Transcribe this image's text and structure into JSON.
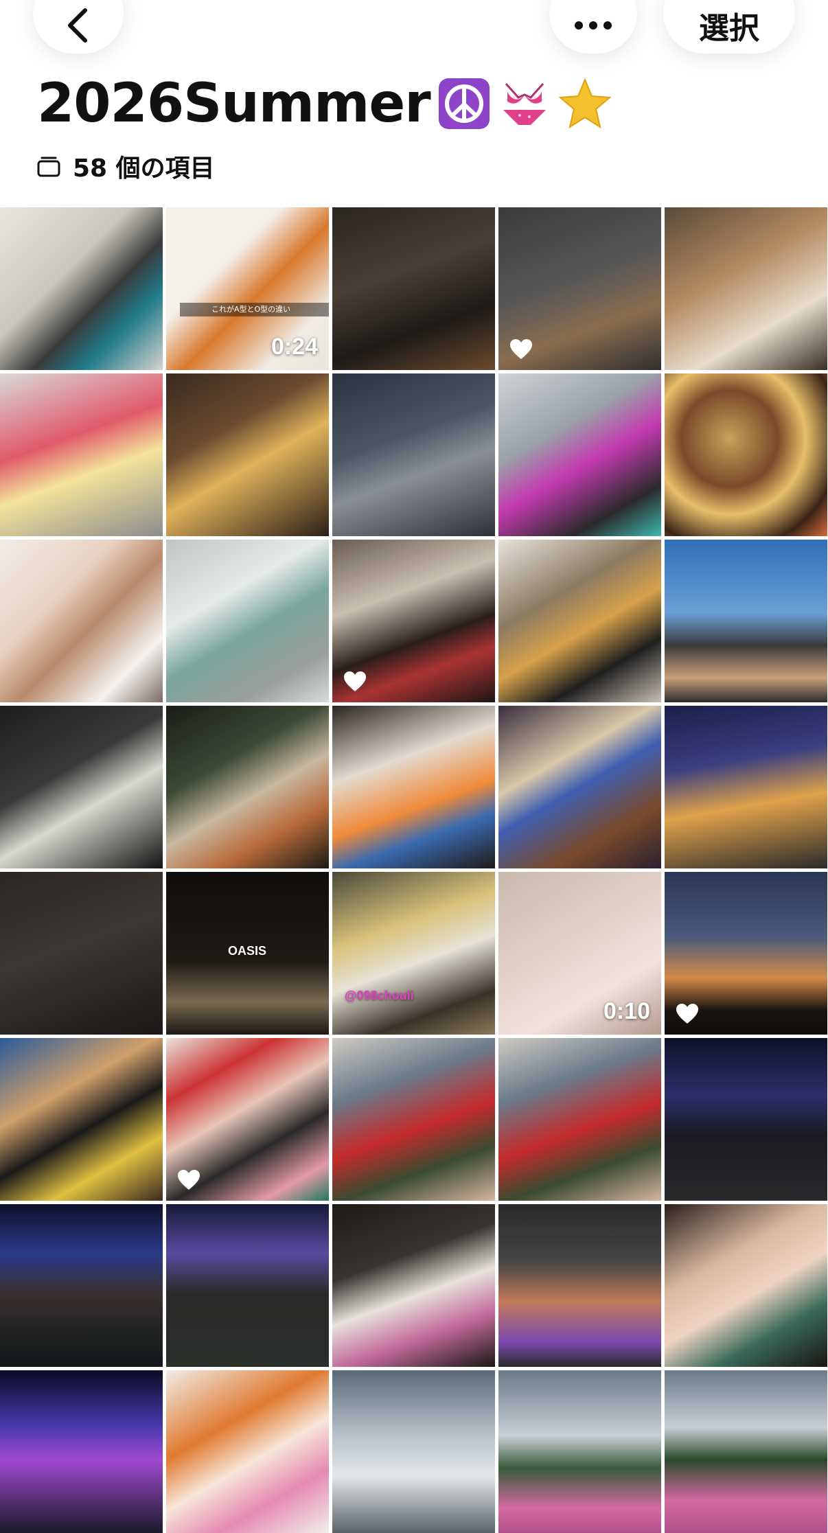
{
  "header": {
    "select_label": "選択",
    "back_icon": "chevron-left-icon",
    "more_icon": "ellipsis-icon"
  },
  "album": {
    "title": "2026Summer",
    "title_emojis": [
      "peace-symbol-emoji",
      "bikini-emoji",
      "star-emoji"
    ],
    "count_label": "58 個の項目",
    "count_icon": "stack-icon"
  },
  "photos": [
    {
      "bg": "linear-gradient(135deg,#e8e6e0 0%,#cbc7bd 40%,#3a3a3a 60%,#1f7a8a 75%,#d7d4cc 100%)"
    },
    {
      "bg": "linear-gradient(135deg,#f4f1ea 0%,#f4f1ea 35%,#d9782c 55%,#f0ece4 80%,#e9e5dd 100%)",
      "duration": "0:24",
      "caption": "これがA型とO型の違い"
    },
    {
      "bg": "linear-gradient(160deg,#2a2520 0%,#4a3f35 40%,#1d1a17 70%,#6b4a2d 100%)"
    },
    {
      "bg": "linear-gradient(160deg,#3b3b3b 0%,#575757 45%,#8a6d4f 70%,#2f2f2f 100%)",
      "favorite": true
    },
    {
      "bg": "linear-gradient(150deg,#5a4a3a 0%,#b48a60 40%,#e8dccb 70%,#3a2e24 100%)"
    },
    {
      "bg": "linear-gradient(160deg,#d9d9d9 0%,#e05a6a 40%,#f4e39a 60%,#8c8c8c 100%)"
    },
    {
      "bg": "linear-gradient(150deg,#3a2a1e 0%,#6b4b30 35%,#e0b25a 55%,#2b1f17 100%)"
    },
    {
      "bg": "linear-gradient(160deg,#2a3340 0%,#4b5766 40%,#8a8f95 60%,#2d3038 100%)"
    },
    {
      "bg": "linear-gradient(150deg,#cfd3d6 0%,#9aa2a8 35%,#c33ab0 55%,#2a2a2a 80%,#3fb7b0 100%)"
    },
    {
      "bg": "radial-gradient(circle at 40% 40%,#c9a05a 0%,#7a4a2a 35%,#e8c06a 55%,#3a2418 80%,#d86a3a 100%)"
    },
    {
      "bg": "linear-gradient(135deg,#f3ece6 0%,#e8d2c2 35%,#b9896a 55%,#f5f3f0 80%,#7a6a60 100%)"
    },
    {
      "bg": "linear-gradient(150deg,#bfc6c4 0%,#e6eaea 35%,#7aa69c 55%,#9a9e9c 80%,#d8dcdb 100%)"
    },
    {
      "bg": "linear-gradient(160deg,#6a5c52 0%,#cbbfb0 35%,#2a1e1a 60%,#a33 75%,#1d1614 100%)",
      "favorite": true
    },
    {
      "bg": "linear-gradient(150deg,#e7e2da 0%,#8c7a62 35%,#d6a14a 55%,#1f1f1f 75%,#c8bfb4 100%)"
    },
    {
      "bg": "linear-gradient(180deg,#2f6fb8 0%,#6a9fd6 45%,#3a3a3a 65%,#c9a07a 85%,#2a2a2a 100%)"
    },
    {
      "bg": "linear-gradient(150deg,#1e1e1e 0%,#3a3a3a 40%,#d8d8d0 60%,#111 100%)"
    },
    {
      "bg": "linear-gradient(150deg,#1a1d18 0%,#3c4a34 35%,#c8b8a0 55%,#b86a3a 75%,#1a1a14 100%)"
    },
    {
      "bg": "linear-gradient(160deg,#2a2420 0%,#e3dbd0 35%,#f08a3a 60%,#3a6ab0 75%,#1f1a17 100%)"
    },
    {
      "bg": "linear-gradient(150deg,#3a2e40 0%,#d9c7a8 35%,#3f5fb0 50%,#7a4a2a 75%,#2a2030 100%)"
    },
    {
      "bg": "linear-gradient(170deg,#1a1f4a 0%,#3a3f80 35%,#e0a24a 60%,#2a2a2a 100%)"
    },
    {
      "bg": "linear-gradient(160deg,#2a2623 0%,#3d3733 45%,#1a1716 100%)"
    },
    {
      "bg": "linear-gradient(180deg,#0f0d0b 0%,#1f1a15 55%,#7a6a50 80%,#1c1814 100%)",
      "overlay_text": "OASIS"
    },
    {
      "bg": "linear-gradient(160deg,#4a4a3a 0%,#d9c27a 35%,#e6e2d6 55%,#3a3226 80%,#8a7a5a 100%)",
      "overlay_text": "@098chouli"
    },
    {
      "bg": "linear-gradient(150deg,#cbb8ad 0%,#e2cfc5 40%,#f3e2dc 70%,#b49a8e 100%)",
      "duration": "0:10"
    },
    {
      "bg": "linear-gradient(180deg,#2a3656 0%,#4a5a7a 40%,#d48a4a 65%,#1a1410 85%,#0f0c0a 100%)",
      "favorite": true
    },
    {
      "bg": "linear-gradient(150deg,#2a5a9a 0%,#d0a06a 35%,#1a1a1a 55%,#e0c040 75%,#3a2a20 100%)"
    },
    {
      "bg": "linear-gradient(150deg,#e9e4dc 0%,#c33 25%,#e8c6b8 45%,#2a2a2a 65%,#e39aa6 85%,#1f7a60 100%)",
      "favorite": true
    },
    {
      "bg": "linear-gradient(160deg,#cfcac2 0%,#6a7a8a 30%,#c42b2b 55%,#3a4a30 75%,#d6b5a0 100%)"
    },
    {
      "bg": "linear-gradient(160deg,#cfcac2 0%,#6a7a8a 30%,#c42b2b 55%,#3a4a30 75%,#d6b5a0 100%)"
    },
    {
      "bg": "linear-gradient(180deg,#0e1128 0%,#2a2f6a 35%,#1a1a22 60%,#2a2a2c 100%)"
    },
    {
      "bg": "linear-gradient(180deg,#0e1128 0%,#2a3a8a 30%,#3a3030 55%,#1f2220 80%,#14161a 100%)"
    },
    {
      "bg": "linear-gradient(180deg,#161a38 0%,#5a4aa0 30%,#2a2a28 55%,#2a2f2a 100%)"
    },
    {
      "bg": "linear-gradient(160deg,#1d1a18 0%,#3a3430 35%,#e7e2dc 55%,#c26a9a 75%,#1a1816 100%)"
    },
    {
      "bg": "linear-gradient(180deg,#2a2a2a 0%,#454545 35%,#c27a5a 60%,#7a4ab0 85%,#2a2a2a 100%)"
    },
    {
      "bg": "linear-gradient(150deg,#2a1f1a 0%,#d9b8a0 35%,#f0d4c2 55%,#3a6a5a 75%,#1a1412 100%)"
    },
    {
      "bg": "linear-gradient(180deg,#0a0c24 0%,#4a3ab0 35%,#a04ad0 55%,#1a1a2a 100%)"
    },
    {
      "bg": "linear-gradient(150deg,#f0ece6 0%,#e07a30 35%,#f7e6d8 55%,#e58ab2 75%,#f2eeea 100%)"
    },
    {
      "bg": "linear-gradient(180deg,#5a6a7a 0%,#b8c2ca 40%,#e3e7ea 65%,#5a6268 100%)"
    },
    {
      "bg": "linear-gradient(180deg,#6a7a8a 0%,#c8d0d6 40%,#3a5a3a 60%,#d46aa0 85%,#b0508a 100%)"
    },
    {
      "bg": "linear-gradient(180deg,#6a7a8a 0%,#c8d0d6 35%,#2a4a2a 55%,#d46aa0 80%,#b0508a 100%)"
    }
  ]
}
